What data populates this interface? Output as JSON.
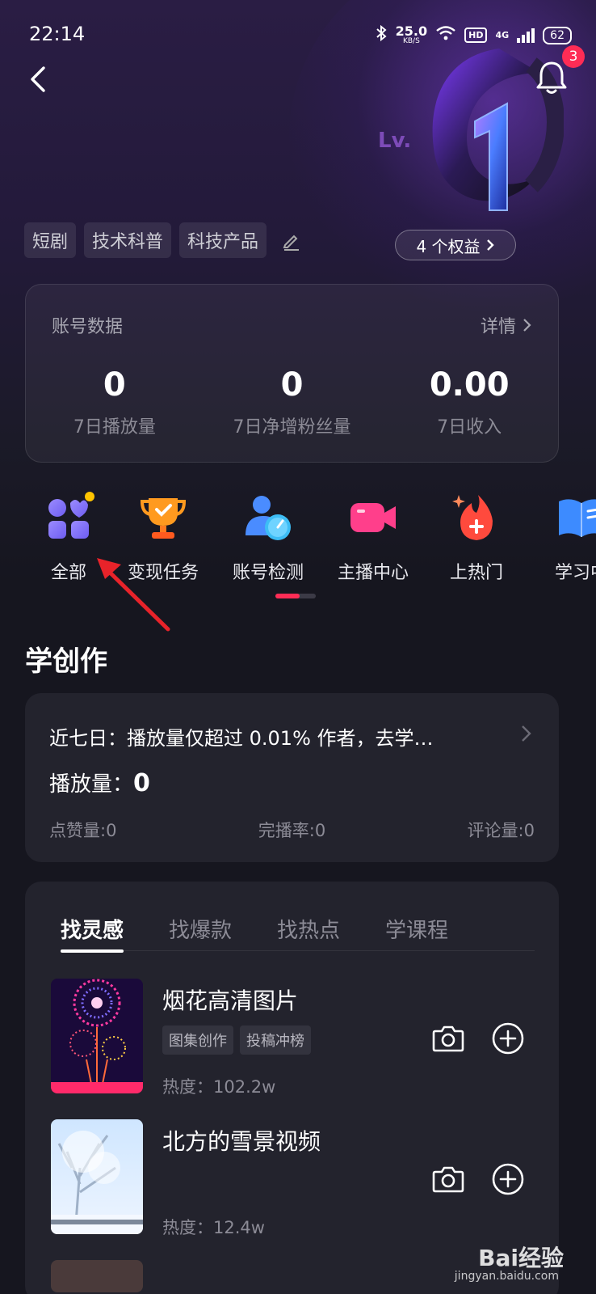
{
  "status_bar": {
    "time": "22:14",
    "speed_value": "25.0",
    "speed_unit": "KB/S",
    "hd_label": "HD",
    "network_label": "4G",
    "battery": "62"
  },
  "header": {
    "notification_count": "3",
    "level_prefix": "Lv.",
    "level_number": "1",
    "rights_label": "4 个权益",
    "tags": [
      "短剧",
      "技术科普",
      "科技产品"
    ]
  },
  "account": {
    "title": "账号数据",
    "detail_label": "详情",
    "stats": [
      {
        "value": "0",
        "label": "7日播放量"
      },
      {
        "value": "0",
        "label": "7日净增粉丝量"
      },
      {
        "value": "0.00",
        "label": "7日收入"
      }
    ]
  },
  "quick_entries": [
    {
      "label": "全部",
      "icon": "grid-apps-icon"
    },
    {
      "label": "变现任务",
      "icon": "trophy-icon"
    },
    {
      "label": "账号检测",
      "icon": "account-check-icon"
    },
    {
      "label": "主播中心",
      "icon": "video-camera-icon"
    },
    {
      "label": "上热门",
      "icon": "flame-icon"
    },
    {
      "label": "学习中",
      "icon": "book-icon"
    }
  ],
  "learn": {
    "section_title": "学创作",
    "summary": "近七日：播放量仅超过 0.01% 作者，去学…",
    "play_label": "播放量：",
    "play_value": "0",
    "likes": "点赞量:0",
    "completion": "完播率:0",
    "comments": "评论量:0"
  },
  "inspiration": {
    "tabs": [
      "找灵感",
      "找爆款",
      "找热点",
      "学课程"
    ],
    "active_tab": 0,
    "items": [
      {
        "title": "烟花高清图片",
        "tags": [
          "图集创作",
          "投稿冲榜"
        ],
        "heat": "热度：102.2w",
        "thumb": "fireworks"
      },
      {
        "title": "北方的雪景视频",
        "tags": [],
        "heat": "热度：12.4w",
        "thumb": "snow"
      }
    ]
  },
  "watermark": {
    "brand": "Bai经验",
    "site": "jingyan.baidu.com"
  },
  "colors": {
    "accent": "#fe2c55",
    "background": "#16161f",
    "card": "#23232d"
  }
}
